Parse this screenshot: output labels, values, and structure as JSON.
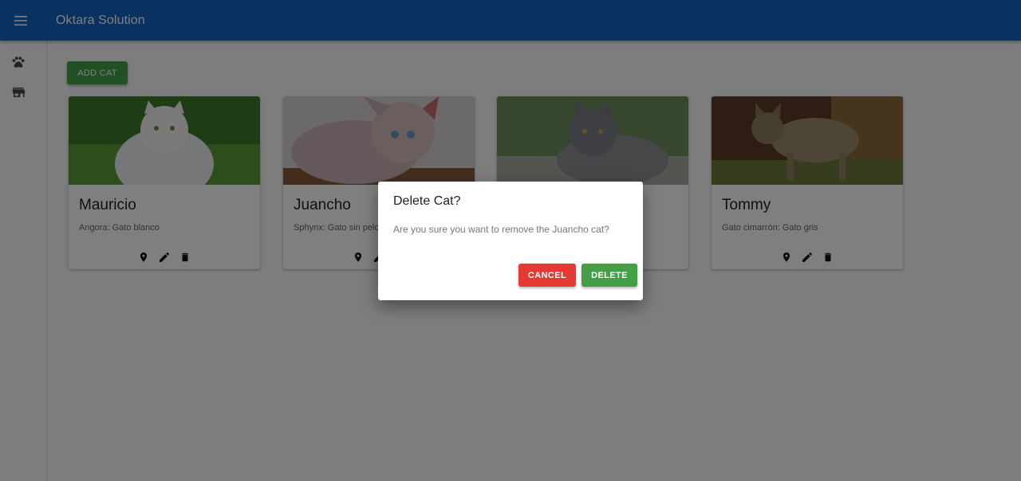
{
  "appbar": {
    "title": "Oktara Solution",
    "color": "#1565c0"
  },
  "drawer": {
    "items": [
      {
        "icon": "paw-icon"
      },
      {
        "icon": "store-icon"
      }
    ]
  },
  "main": {
    "add_button": "ADD CAT",
    "cards": [
      {
        "name": "Mauricio",
        "description": "Angora: Gato blanco"
      },
      {
        "name": "Juancho",
        "description": "Sphynx: Gato sin pelo"
      },
      {
        "name": "",
        "description": ""
      },
      {
        "name": "Tommy",
        "description": "Gato cimarrón: Gato gris"
      }
    ]
  },
  "dialog": {
    "title": "Delete Cat?",
    "text": "Are you sure you want to remove the Juancho cat?",
    "cancel_label": "CANCEL",
    "delete_label": "DELETE"
  },
  "colors": {
    "cancel": "#e53935",
    "delete": "#43a047",
    "add": "#43a047"
  }
}
